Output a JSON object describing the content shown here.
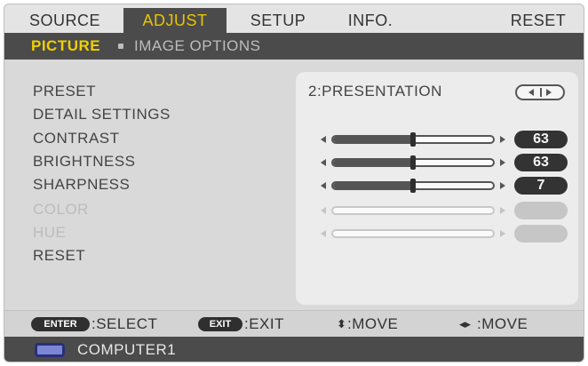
{
  "tabs": [
    {
      "label": "SOURCE",
      "active": false
    },
    {
      "label": "ADJUST",
      "active": true
    },
    {
      "label": "SETUP",
      "active": false
    },
    {
      "label": "INFO.",
      "active": false
    },
    {
      "label": "RESET",
      "active": false
    }
  ],
  "subtabs": [
    {
      "label": "PICTURE",
      "active": true
    },
    {
      "label": "IMAGE OPTIONS",
      "active": false
    }
  ],
  "settings": {
    "preset": {
      "label": "PRESET",
      "value": "2:PRESENTATION"
    },
    "detail": {
      "label": "DETAIL SETTINGS"
    },
    "contrast": {
      "label": "CONTRAST",
      "value": "63",
      "level": 0.5
    },
    "brightness": {
      "label": "BRIGHTNESS",
      "value": "63",
      "level": 0.5
    },
    "sharpness": {
      "label": "SHARPNESS",
      "value": "7",
      "level": 0.5
    },
    "color": {
      "label": "COLOR",
      "value": "",
      "enabled": false
    },
    "hue": {
      "label": "HUE",
      "value": "",
      "enabled": false
    },
    "reset": {
      "label": "RESET"
    }
  },
  "footer": {
    "enter_key": "ENTER",
    "select": ":SELECT",
    "exit_key": "EXIT",
    "exit": ":EXIT",
    "move_ud": ":MOVE",
    "move_lr": ":MOVE"
  },
  "status": {
    "source": "COMPUTER1"
  },
  "colors": {
    "accent": "#e8c400",
    "bar": "#4b4b4b"
  }
}
